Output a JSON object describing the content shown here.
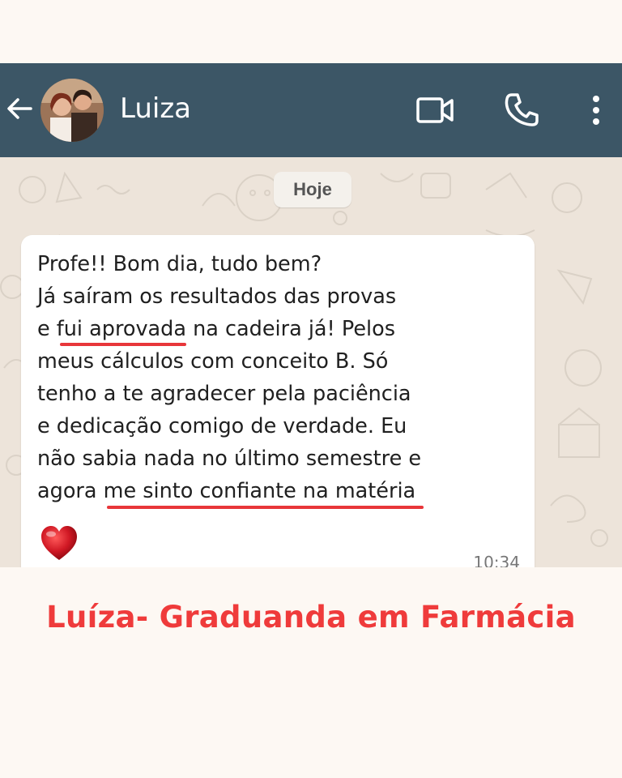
{
  "header": {
    "contact_name": "Luiza",
    "icons": [
      "back-arrow-icon",
      "avatar",
      "video-call-icon",
      "voice-call-icon",
      "more-options-icon"
    ],
    "background_color": "#3c5666"
  },
  "chat": {
    "date_label": "Hoje",
    "message": {
      "lines": [
        "Profe!! Bom dia, tudo bem?",
        "Já saíram os resultados das provas",
        "e ",
        "meus cálculos com conceito B. Só",
        "tenho a te agradecer pela paciência",
        "e dedicação comigo de verdade. Eu",
        "não sabia nada no último semestre e",
        "agora "
      ],
      "highlight_1": "fui aprovada",
      "after_highlight_1": " na cadeira já! Pelos",
      "highlight_2": "me sinto confiante na matéria",
      "emoji": "heart-icon",
      "time": "10:34"
    }
  },
  "caption": {
    "text": "Luíza- Graduanda em Farmácia",
    "color": "#ef3b3b"
  }
}
